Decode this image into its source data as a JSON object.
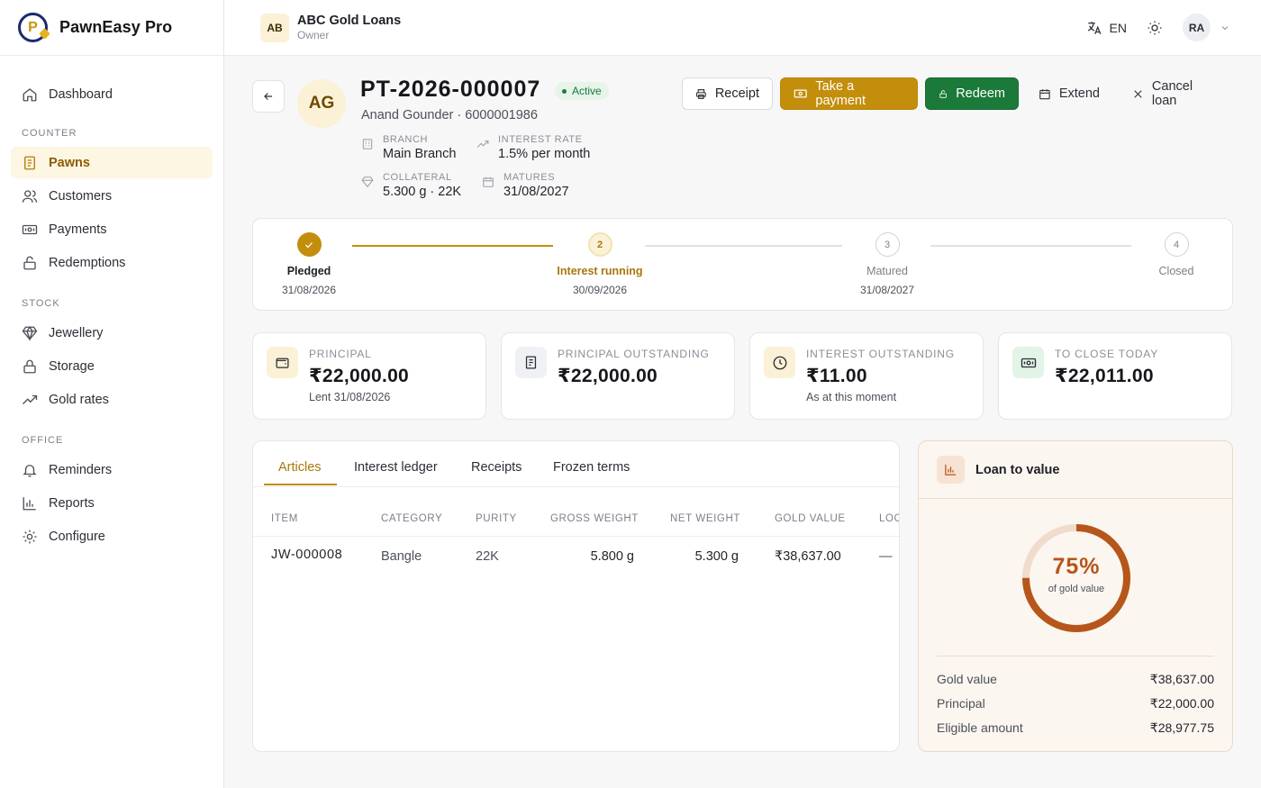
{
  "brand": {
    "name": "PawnEasy Pro",
    "logo_letter": "P"
  },
  "sidebar": {
    "top": {
      "label": "Dashboard"
    },
    "sections": {
      "counter": {
        "title": "COUNTER",
        "items": [
          "Pawns",
          "Customers",
          "Payments",
          "Redemptions"
        ]
      },
      "stock": {
        "title": "STOCK",
        "items": [
          "Jewellery",
          "Storage",
          "Gold rates"
        ]
      },
      "office": {
        "title": "OFFICE",
        "items": [
          "Reminders",
          "Reports",
          "Configure"
        ]
      }
    },
    "active": "Pawns"
  },
  "topbar": {
    "org_initials": "AB",
    "org_name": "ABC Gold Loans",
    "org_role": "Owner",
    "language": "EN",
    "user_initials": "RA"
  },
  "loan": {
    "customer_initials": "AG",
    "number": "PT-2026-000007",
    "status": "Active",
    "customer_line": "Anand Gounder · 6000001986",
    "meta": {
      "branch_label": "BRANCH",
      "branch": "Main Branch",
      "rate_label": "INTEREST RATE",
      "rate": "1.5% per month",
      "collateral_label": "COLLATERAL",
      "collateral": "5.300 g · 22K",
      "matures_label": "MATURES",
      "matures": "31/08/2027"
    },
    "actions": {
      "receipt": "Receipt",
      "take_payment": "Take a payment",
      "redeem": "Redeem",
      "extend": "Extend",
      "cancel": "Cancel loan"
    }
  },
  "stepper": [
    {
      "number": "1",
      "label": "Pledged",
      "date": "31/08/2026",
      "state": "done"
    },
    {
      "number": "2",
      "label": "Interest running",
      "date": "30/09/2026",
      "state": "current"
    },
    {
      "number": "3",
      "label": "Matured",
      "date": "31/08/2027",
      "state": "todo"
    },
    {
      "number": "4",
      "label": "Closed",
      "date": "",
      "state": "todo"
    }
  ],
  "stats": [
    {
      "label": "PRINCIPAL",
      "value": "₹22,000.00",
      "sub": "Lent 31/08/2026",
      "icon": "wallet-icon"
    },
    {
      "label": "PRINCIPAL OUTSTANDING",
      "value": "₹22,000.00",
      "sub": "",
      "icon": "receipt-icon"
    },
    {
      "label": "INTEREST OUTSTANDING",
      "value": "₹11.00",
      "sub": "As at this moment",
      "icon": "clock-icon"
    },
    {
      "label": "TO CLOSE TODAY",
      "value": "₹22,011.00",
      "sub": "",
      "icon": "banknote-icon"
    }
  ],
  "tabs": [
    "Articles",
    "Interest ledger",
    "Receipts",
    "Frozen terms"
  ],
  "active_tab": "Articles",
  "articles": {
    "columns": [
      "ITEM",
      "CATEGORY",
      "PURITY",
      "GROSS WEIGHT",
      "NET WEIGHT",
      "GOLD VALUE",
      "LOC"
    ],
    "rows": [
      {
        "item": "JW-000008",
        "category": "Bangle",
        "purity": "22K",
        "gross": "5.800 g",
        "net": "5.300 g",
        "value": "₹38,637.00",
        "loc": "—"
      }
    ]
  },
  "ltv": {
    "title": "Loan to value",
    "percent_text": "75%",
    "percent": 0.75,
    "subtitle": "of gold value",
    "rows": [
      {
        "label": "Gold value",
        "value": "₹38,637.00"
      },
      {
        "label": "Principal",
        "value": "₹22,000.00"
      },
      {
        "label": "Eligible amount",
        "value": "₹28,977.75"
      }
    ]
  },
  "colors": {
    "gold": "#c38e0c",
    "green": "#1b7a3a",
    "ltv_arc": "#b6561a",
    "ltv_track": "#f1dccb"
  }
}
